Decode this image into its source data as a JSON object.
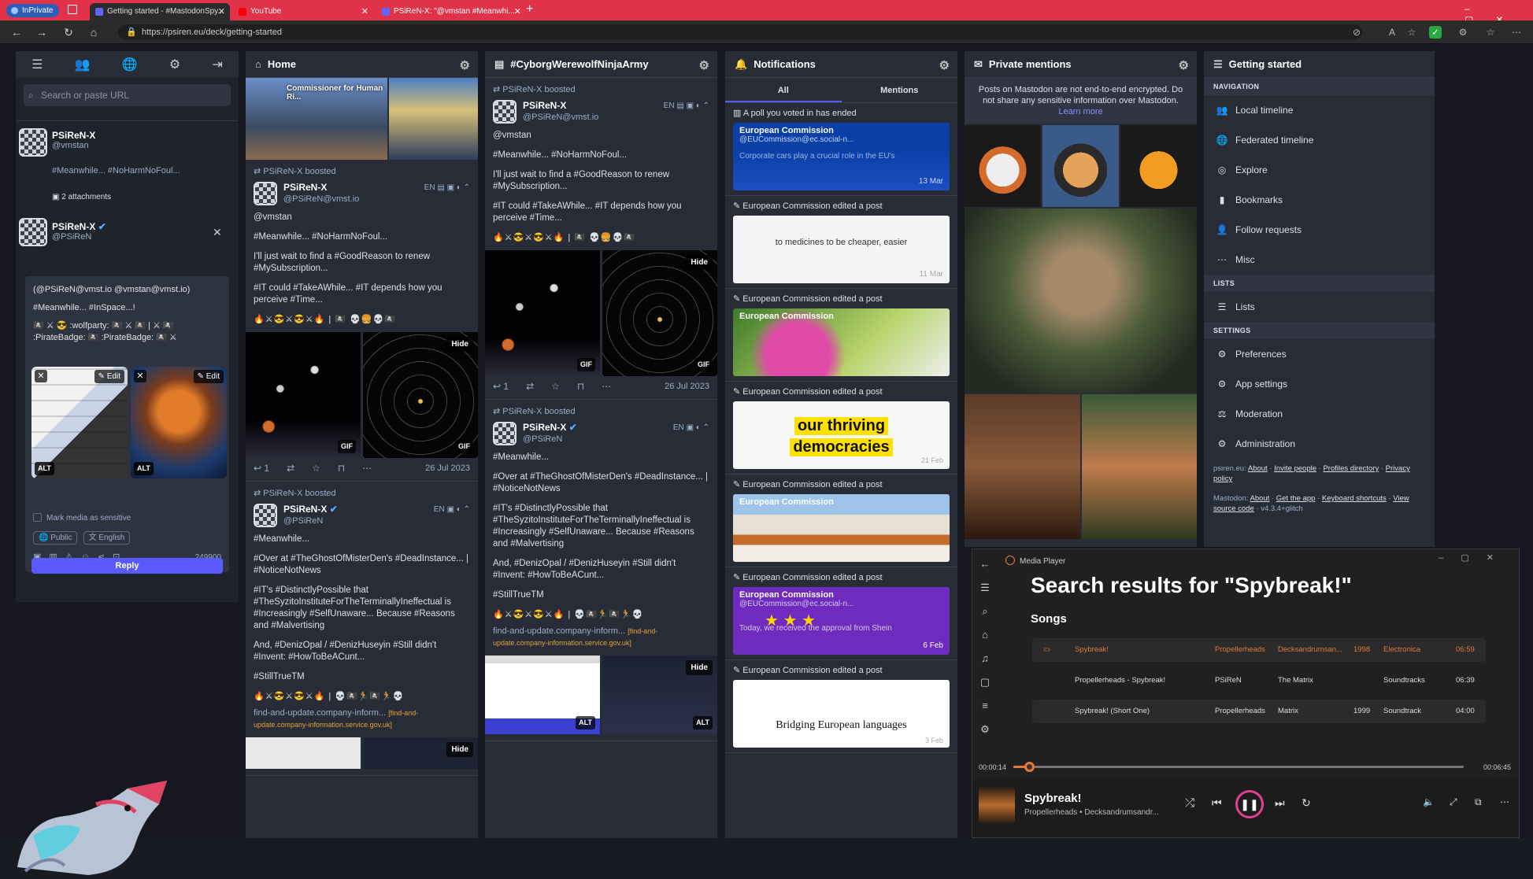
{
  "browser": {
    "inprivate": "InPrivate",
    "tabs": [
      {
        "title": "Getting started - #MastodonSpy...",
        "color": "#6364ff"
      },
      {
        "title": "YouTube",
        "color": "#ff0000"
      },
      {
        "title": "PSiReN-X: \"@vmstan #Meanwhi...",
        "color": "#6364ff"
      }
    ],
    "url": "https://psiren.eu/deck/getting-started"
  },
  "compose": {
    "search_placeholder": "Search or paste URL",
    "reply_to": {
      "name": "PSiReN-X",
      "handle": "@vmstan",
      "text": "#Meanwhile... #NoHarmNoFoul...",
      "attachments": "2 attachments"
    },
    "me": {
      "name": "PSiReN-X",
      "handle": "@PSiReN"
    },
    "draft_line1": "(@PSiReN@vmst.io @vmstan@vmst.io)",
    "draft_line2": "#Meanwhile... #InSpace...!",
    "draft_line3": "🏴‍☠️ ⚔ 😎 :wolfparty: 🏴‍☠️ ⚔ 🏴‍☠️ | ⚔ 🏴‍☠️ :PirateBadge: 🏴‍☠️ :PirateBadge: 🏴‍☠️ ⚔",
    "edit": "Edit",
    "alt": "ALT",
    "sensitive": "Mark media as sensitive",
    "visibility": "Public",
    "language": "English",
    "char_count": "249900",
    "reply": "Reply"
  },
  "home": {
    "title": "Home",
    "banner": "Commissioner for Human Ri...",
    "boosted": "PSiReN-X boosted",
    "post1": {
      "name": "PSiReN-X",
      "handle": "@PSiReN@vmst.io",
      "lang": "EN",
      "mention": "@vmstan",
      "p1": "#Meanwhile... #NoHarmNoFoul...",
      "p2": "I'll just wait to find a #GoodReason to renew #MySubscription...",
      "p3": "#IT could #TakeAWhile... #IT depends how you perceive #Time...",
      "replies": "1",
      "date": "26 Jul 2023"
    },
    "post2": {
      "name": "PSiReN-X",
      "handle": "@PSiReN",
      "lang": "EN",
      "p1": "#Meanwhile...",
      "p2": "#Over at #TheGhostOfMisterDen's #DeadInstance... | #NoticeNotNews",
      "p3": "#IT's #DistinctlyPossible that #TheSyzitoInstituteForTheTerminallyIneffectual is #Increasingly #SelfUnaware... Because #Reasons and #Malvertising",
      "p4": "And, #DenizOpal / #DenizHuseyin #Still didn't #Invent: #HowToBeACunt...",
      "p5": "#StillTrueTM",
      "link": "find-and-update.company-inform...",
      "link_small": "[find-and-update.company-information.service.gov.uk]"
    },
    "gif": "GIF",
    "hide": "Hide"
  },
  "cyborg": {
    "title": "#CyborgWerewolfNinjaArmy"
  },
  "notifications": {
    "title": "Notifications",
    "tab_all": "All",
    "tab_mentions": "Mentions",
    "poll": "A poll you voted in has ended",
    "edited": "European Commission edited a post",
    "ec_name": "European Commission",
    "ec_handle": "@EUCommission@ec.social-n...",
    "card1_text": "Corporate cars play a crucial role in the EU's",
    "card1_date": "13 Mar",
    "card2_text": "to medicines to be cheaper, easier",
    "card2_date": "11 Mar",
    "card4_text1": "our thriving",
    "card4_text2": "democracies",
    "card4_date": "21 Feb",
    "card6_text": "Today, we received the approval from Shein",
    "card6_date": "6 Feb",
    "card7_text": "Bridging European languages",
    "card7_date": "3 Feb"
  },
  "mentions": {
    "title": "Private mentions",
    "note": "Posts on Mastodon are not end-to-end encrypted. Do not share any sensitive information over Mastodon.",
    "learn": "Learn more"
  },
  "getting_started": {
    "title": "Getting started",
    "sec_nav": "NAVIGATION",
    "local": "Local timeline",
    "federated": "Federated timeline",
    "explore": "Explore",
    "bookmarks": "Bookmarks",
    "follow_requests": "Follow requests",
    "misc": "Misc",
    "sec_lists": "LISTS",
    "lists": "Lists",
    "sec_settings": "SETTINGS",
    "preferences": "Preferences",
    "app_settings": "App settings",
    "moderation": "Moderation",
    "administration": "Administration",
    "foot1_prefix": "psiren.eu:",
    "foot1_about": "About",
    "foot1_invite": "Invite people",
    "foot1_profiles": "Profiles directory",
    "foot1_privacy": "Privacy policy",
    "foot2_prefix": "Mastodon:",
    "foot2_about": "About",
    "foot2_app": "Get the app",
    "foot2_keys": "Keyboard shortcuts",
    "foot2_view": "View source code",
    "foot2_version": "· v4.3.4+glitch"
  },
  "player": {
    "app": "Media Player",
    "heading": "Search results for \"Spybreak!\"",
    "songs_label": "Songs",
    "songs": [
      {
        "title": "Spybreak!",
        "artist": "Propellerheads",
        "album": "Decksandrumsan...",
        "year": "1998",
        "genre": "Electronica",
        "dur": "06:59"
      },
      {
        "title": "Propellerheads - Spybreak!",
        "artist": "PSiReN",
        "album": "The Matrix",
        "year": "",
        "genre": "Soundtracks",
        "dur": "06:39"
      },
      {
        "title": "Spybreak! (Short One)",
        "artist": "Propellerheads",
        "album": "Matrix",
        "year": "1999",
        "genre": "Soundtrack",
        "dur": "04:00"
      }
    ],
    "elapsed": "00:00:14",
    "total": "00:06:45",
    "progress": 0.035,
    "now_title": "Spybreak!",
    "now_artist": "Propellerheads • Decksandrumsandr..."
  }
}
